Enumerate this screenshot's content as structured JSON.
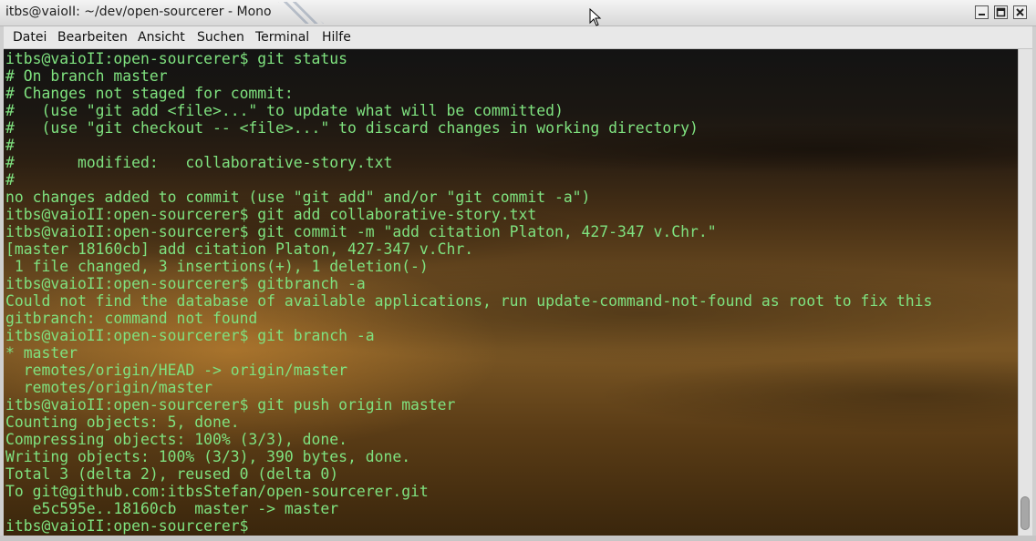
{
  "window": {
    "title": "itbs@vaioII: ~/dev/open-sourcerer - Mono",
    "minimize_icon": "minimize-icon",
    "maximize_icon": "maximize-icon",
    "close_icon": "close-icon"
  },
  "menu": {
    "items": [
      "Datei",
      "Bearbeiten",
      "Ansicht",
      "Suchen",
      "Terminal",
      "Hilfe"
    ]
  },
  "colors": {
    "terminal_text": "#7fe27f",
    "wallpaper_dark": "#131313",
    "wallpaper_sand": "#7a5624"
  },
  "terminal": {
    "lines": [
      "itbs@vaioII:open-sourcerer$ git status",
      "# On branch master",
      "# Changes not staged for commit:",
      "#   (use \"git add <file>...\" to update what will be committed)",
      "#   (use \"git checkout -- <file>...\" to discard changes in working directory)",
      "#",
      "#\tmodified:   collaborative-story.txt",
      "#",
      "no changes added to commit (use \"git add\" and/or \"git commit -a\")",
      "itbs@vaioII:open-sourcerer$ git add collaborative-story.txt",
      "itbs@vaioII:open-sourcerer$ git commit -m \"add citation Platon, 427-347 v.Chr.\"",
      "[master 18160cb] add citation Platon, 427-347 v.Chr.",
      " 1 file changed, 3 insertions(+), 1 deletion(-)",
      "itbs@vaioII:open-sourcerer$ gitbranch -a",
      "Could not find the database of available applications, run update-command-not-found as root to fix this",
      "gitbranch: command not found",
      "itbs@vaioII:open-sourcerer$ git branch -a",
      "* master",
      "  remotes/origin/HEAD -> origin/master",
      "  remotes/origin/master",
      "itbs@vaioII:open-sourcerer$ git push origin master",
      "Counting objects: 5, done.",
      "Compressing objects: 100% (3/3), done.",
      "Writing objects: 100% (3/3), 390 bytes, done.",
      "Total 3 (delta 2), reused 0 (delta 0)",
      "To git@github.com:itbsStefan/open-sourcerer.git",
      "   e5c595e..18160cb  master -> master",
      "itbs@vaioII:open-sourcerer$ "
    ]
  },
  "scrollbar": {
    "thumb_start": 0.92,
    "thumb_fraction": 0.07
  }
}
